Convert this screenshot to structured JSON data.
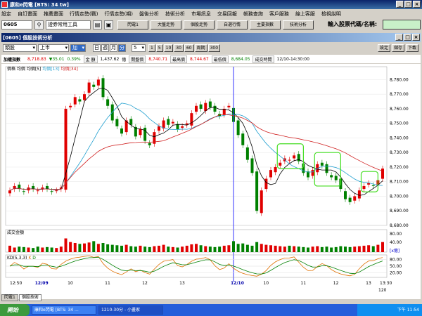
{
  "title": "康和e閃電 [BTS: 34 tw]",
  "menu": [
    "設定",
    "自訂畫面",
    "推薦畫面",
    "行情走勢(戰)",
    "行情走勢(期)",
    "盤後分析",
    "技術分析",
    "市場訊息",
    "交易回報",
    "帳務查詢",
    "客戶服務",
    "線上客服",
    "檢視說明"
  ],
  "toolbar": {
    "code": "0605",
    "dropdown": "證券常用工具",
    "buttons": [
      "閃電1",
      "大盤走勢",
      "個股走勢",
      "自選行情",
      "主要指數",
      "技術分析"
    ],
    "stock_label": "輸入股票代碼/名稱:"
  },
  "window_title": "[0605] 個股技術分析",
  "subbar": {
    "type": "類股",
    "market": "上市",
    "index": "加",
    "periods": [
      "日",
      "週",
      "月",
      "分"
    ],
    "active_period": "分",
    "minutes": "5",
    "buttons": [
      "1",
      "5",
      "10",
      "30",
      "60",
      "周期",
      "300"
    ],
    "right": [
      "設定",
      "儲存",
      "下載"
    ]
  },
  "info": {
    "name": "加權指數",
    "price": "8,718.83",
    "change": "▼35.01",
    "pct": "0.39%",
    "amount_label": "金",
    "amount_label2": "額",
    "amount": "1,437.62",
    "amount_unit": "億",
    "open_label": "開盤價",
    "open": "8,740.71",
    "high_label": "最高價",
    "high": "8,744.67",
    "low_label": "最低價",
    "low": "8,684.05",
    "time_label": "成交時間",
    "time": "12/10-14:30:00"
  },
  "legend": {
    "price": "價格",
    "ma": "均價",
    "ma5": "均價[5]",
    "ma13": "均價[13]",
    "ma34": "均價[34]"
  },
  "volume_label": "成交金額",
  "kd_label": "KD(5,3,3)",
  "kd_k": "K",
  "kd_d": "D",
  "vol_scale": "[x億]",
  "x_scale": "120",
  "tabs": [
    "閃電1",
    "個股技術"
  ],
  "taskbar": {
    "start": "開始",
    "tasks": [
      "康和e閃電 [BTS: 34 ...",
      "1210-30分 - 小畫家"
    ],
    "clock": "下午 11:54"
  },
  "chart_data": {
    "type": "candlestick",
    "price_ticks": [
      8680,
      8690,
      8700,
      8710,
      8720,
      8730,
      8740,
      8750,
      8760,
      8770,
      8780
    ],
    "volume_ticks": [
      80,
      40
    ],
    "kd_ticks": [
      80,
      50,
      20
    ],
    "x_labels": [
      "12:50",
      "12/09",
      "10",
      "11",
      "12",
      "13",
      "12/10",
      "10",
      "11",
      "12",
      "13",
      "13:30"
    ],
    "close": [
      8704,
      8707,
      8705,
      8703,
      8706,
      8705,
      8704,
      8706,
      8705,
      8703,
      8704,
      8706,
      8760,
      8762,
      8768,
      8765,
      8770,
      8778,
      8775,
      8780,
      8768,
      8762,
      8752,
      8748,
      8743,
      8752,
      8749,
      8741,
      8746,
      8738,
      8735,
      8744,
      8748,
      8752,
      8749,
      8751,
      8746,
      8748,
      8750,
      8757,
      8762,
      8760,
      8764,
      8761,
      8758,
      8755,
      8760,
      8762,
      8751,
      8742,
      8735,
      8725,
      8716,
      8690,
      8704,
      8712,
      8718,
      8720,
      8723,
      8726,
      8725,
      8728,
      8724,
      8716,
      8713,
      8718,
      8722,
      8721,
      8716,
      8713,
      8711,
      8705,
      8698,
      8696,
      8700,
      8704,
      8707,
      8709,
      8707,
      8711,
      8719
    ],
    "volume": [
      14,
      10,
      12,
      11,
      10,
      9,
      12,
      10,
      11,
      10,
      9,
      12,
      30,
      22,
      20,
      18,
      19,
      21,
      24,
      18,
      20,
      17,
      16,
      15,
      14,
      16,
      13,
      12,
      14,
      12,
      11,
      13,
      14,
      16,
      12,
      11,
      10,
      12,
      14,
      17,
      18,
      15,
      13,
      12,
      11,
      12,
      14,
      15,
      24,
      18,
      19,
      16,
      14,
      22,
      18,
      16,
      15,
      14,
      13,
      12,
      14,
      13,
      12,
      11,
      10,
      12,
      13,
      11,
      12,
      10,
      11,
      13,
      12,
      11,
      12,
      13,
      14,
      15,
      13,
      16,
      22
    ]
  }
}
